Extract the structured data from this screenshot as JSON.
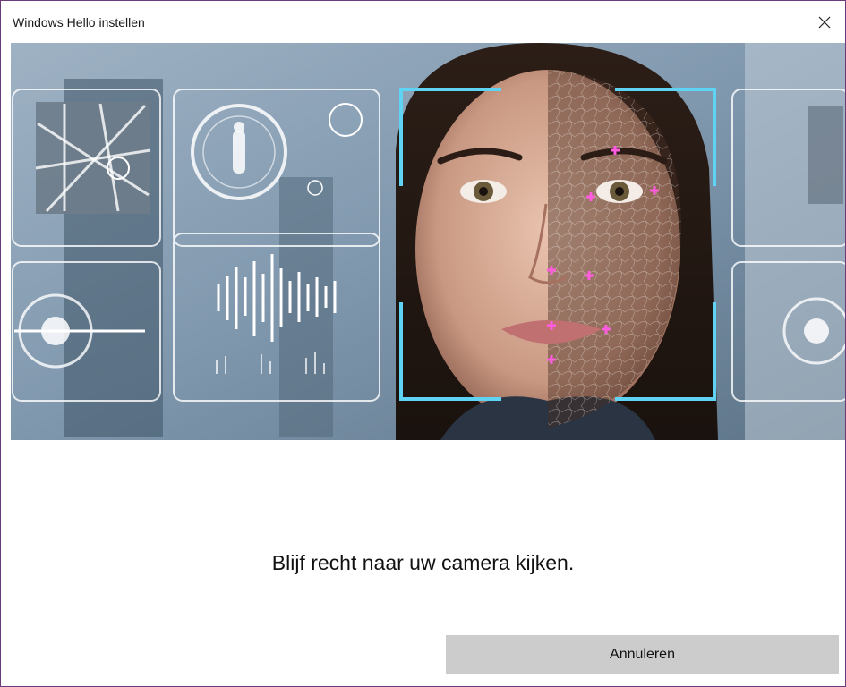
{
  "window": {
    "title": "Windows Hello instellen",
    "close_icon": "close-icon",
    "border_color": "#6b3a78"
  },
  "hero": {
    "description_icon": "face-scan-illustration",
    "accent_color": "#5fd3f3",
    "marker_color": "#ff5ce0"
  },
  "main": {
    "message": "Blijf recht naar uw camera kijken.",
    "cancel_label": "Annuleren"
  }
}
